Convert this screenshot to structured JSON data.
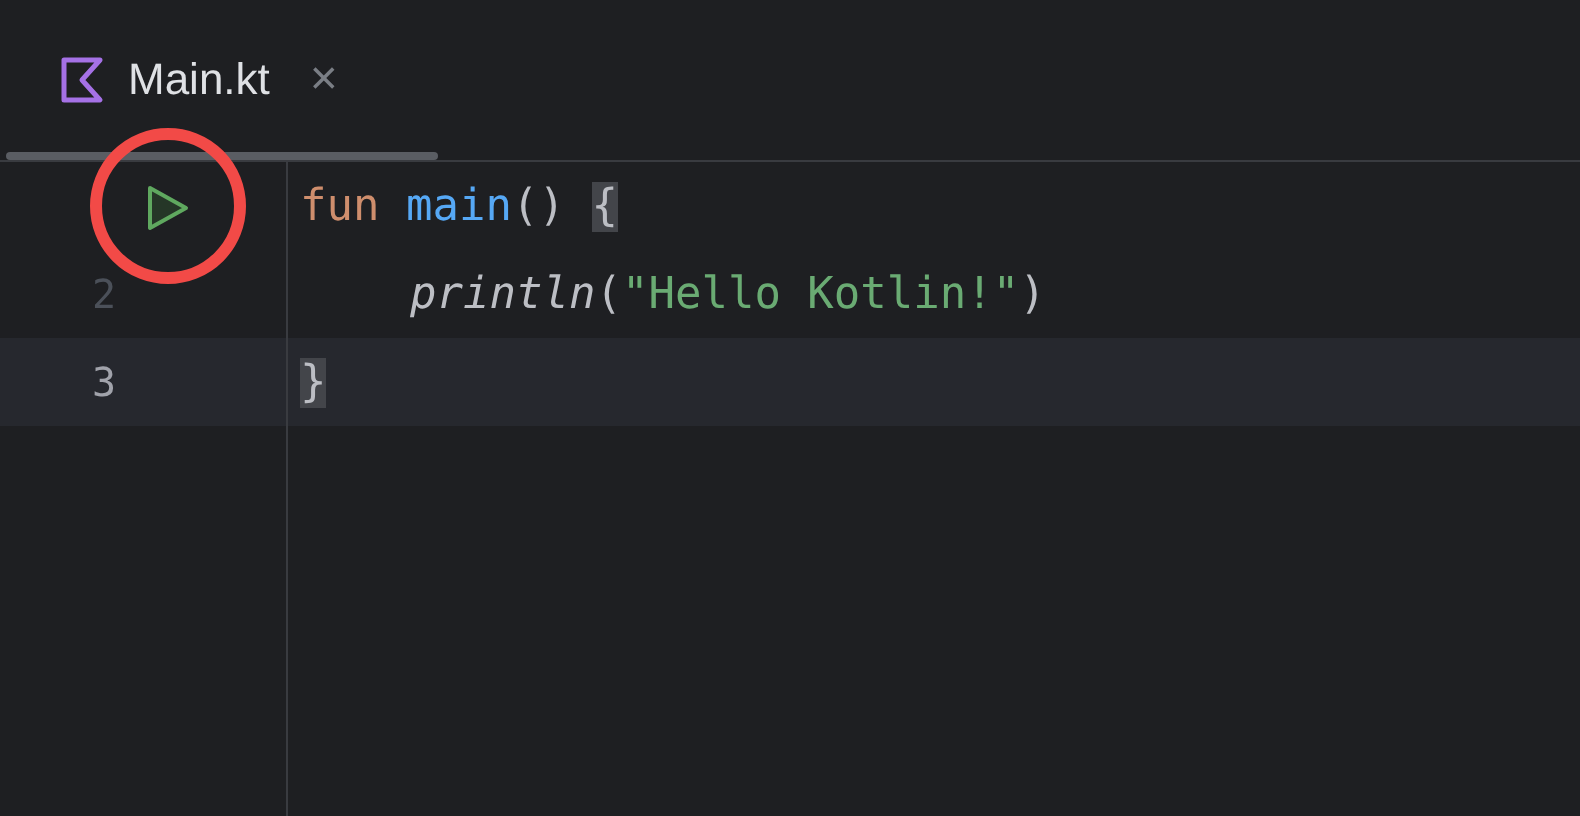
{
  "tab": {
    "title": "Main.kt",
    "close": "×",
    "selected": true
  },
  "lines": [
    {
      "run": true,
      "current": false,
      "indented": false,
      "tokens": [
        {
          "text": "fun ",
          "kind": "keyword"
        },
        {
          "text": "main",
          "kind": "function"
        },
        {
          "text": "() ",
          "kind": "plain"
        },
        {
          "text": "{",
          "kind": "brace-match"
        }
      ]
    },
    {
      "number": "2",
      "run": false,
      "current": false,
      "indented": true,
      "tokens": [
        {
          "text": "println",
          "kind": "call"
        },
        {
          "text": "(",
          "kind": "plain"
        },
        {
          "text": "\"Hello Kotlin!\"",
          "kind": "string"
        },
        {
          "text": ")",
          "kind": "plain"
        }
      ]
    },
    {
      "number": "3",
      "run": false,
      "current": true,
      "indented": false,
      "tokens": [
        {
          "text": "}",
          "kind": "brace-match"
        }
      ]
    }
  ]
}
